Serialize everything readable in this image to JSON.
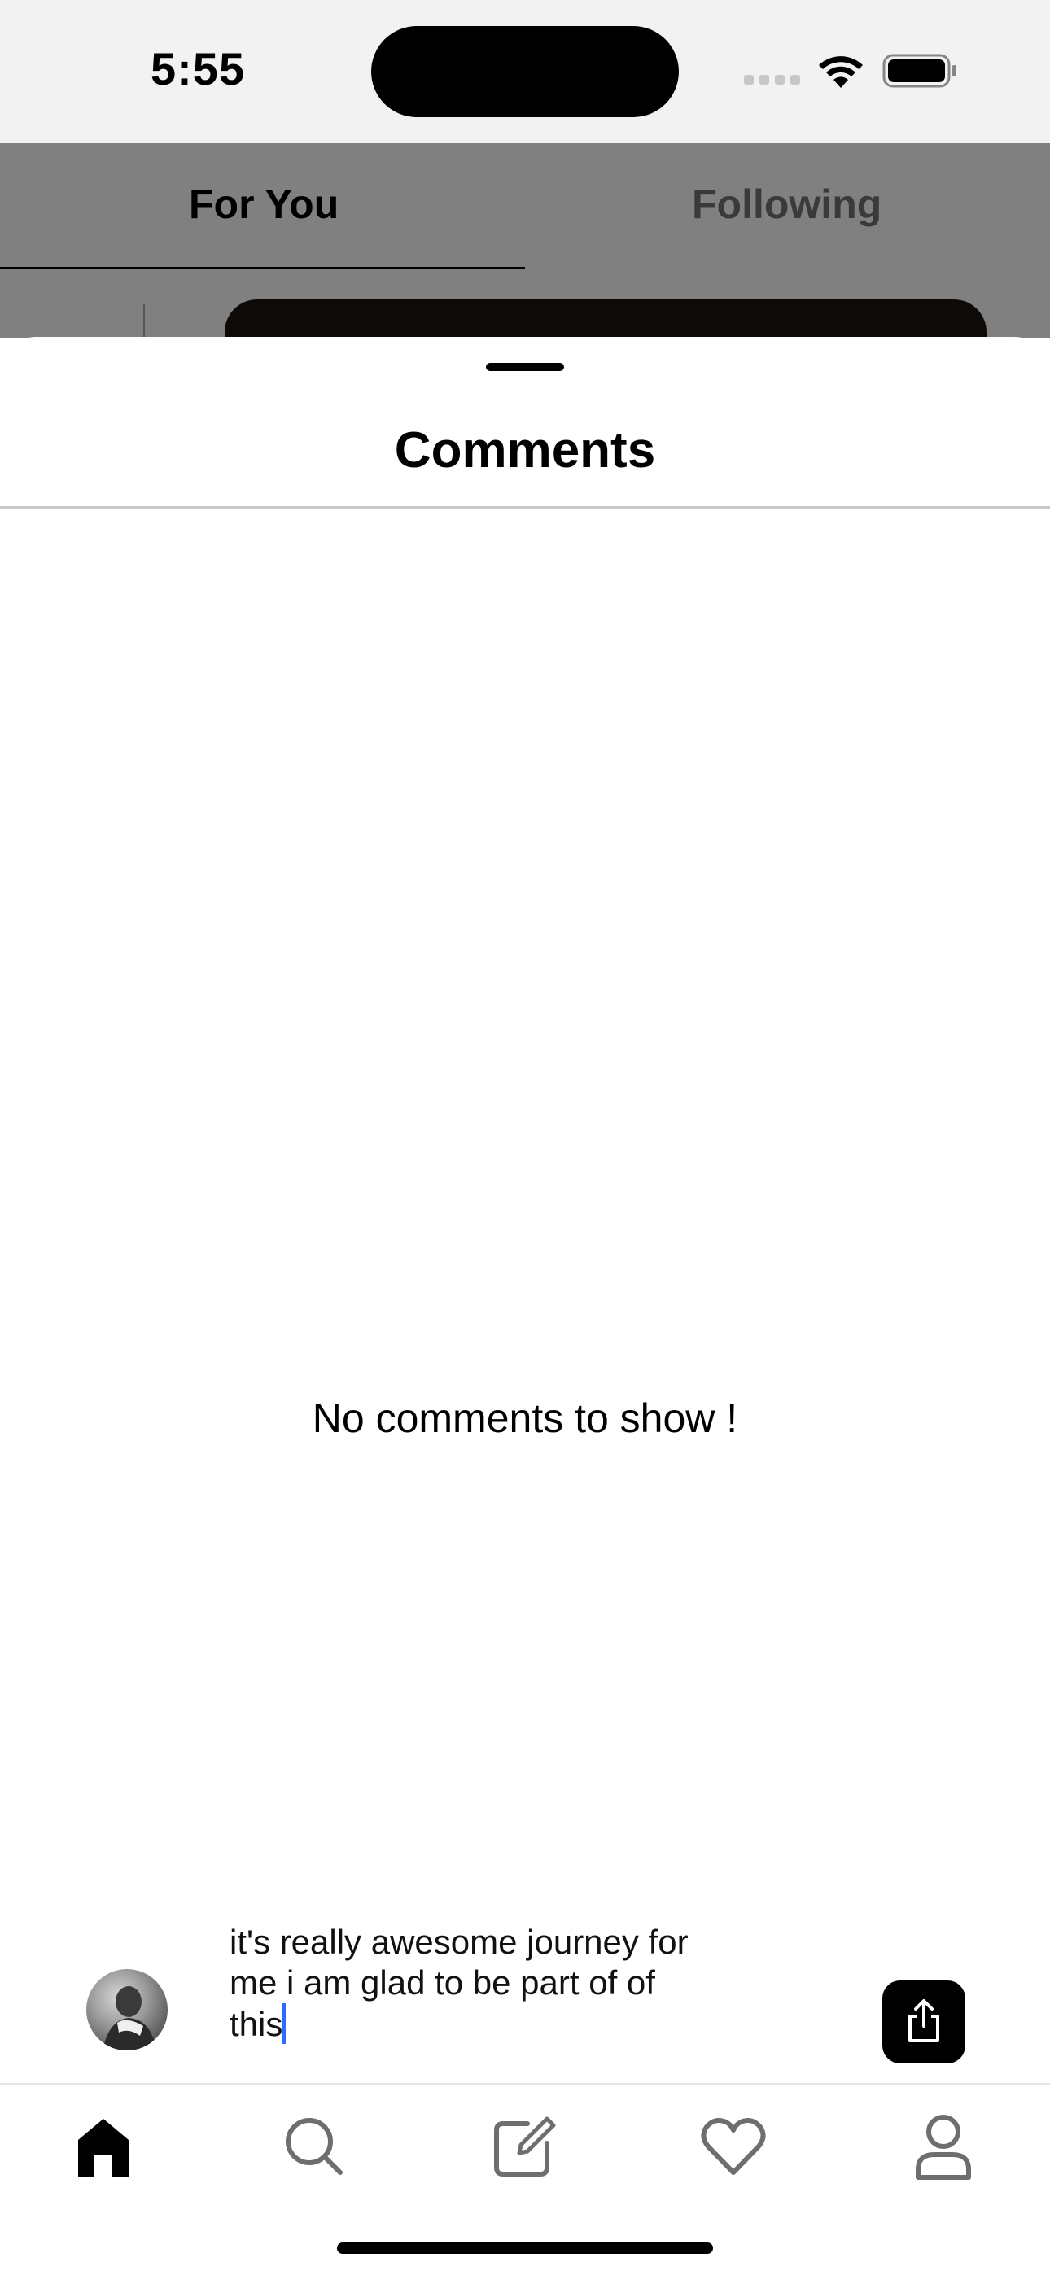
{
  "status_bar": {
    "time": "5:55"
  },
  "feed": {
    "tabs": [
      {
        "label": "For You",
        "selected": true
      },
      {
        "label": "Following",
        "selected": false
      }
    ]
  },
  "comments_sheet": {
    "title": "Comments",
    "empty_message": "No comments to show !"
  },
  "composer": {
    "avatar_icon": "user-avatar",
    "text_lines": [
      "it's really awesome journey for",
      "me i am glad to be part of of",
      "this"
    ],
    "send_icon": "share-upload-icon"
  },
  "tab_bar": {
    "items": [
      {
        "icon": "home-icon",
        "selected": true
      },
      {
        "icon": "search-icon",
        "selected": false
      },
      {
        "icon": "compose-icon",
        "selected": false
      },
      {
        "icon": "heart-icon",
        "selected": false
      },
      {
        "icon": "profile-icon",
        "selected": false
      }
    ]
  },
  "colors": {
    "caret": "#2f6bff",
    "overlay": "#808080",
    "selected_icon": "#000000",
    "unselected_icon": "#6e6e6e"
  }
}
